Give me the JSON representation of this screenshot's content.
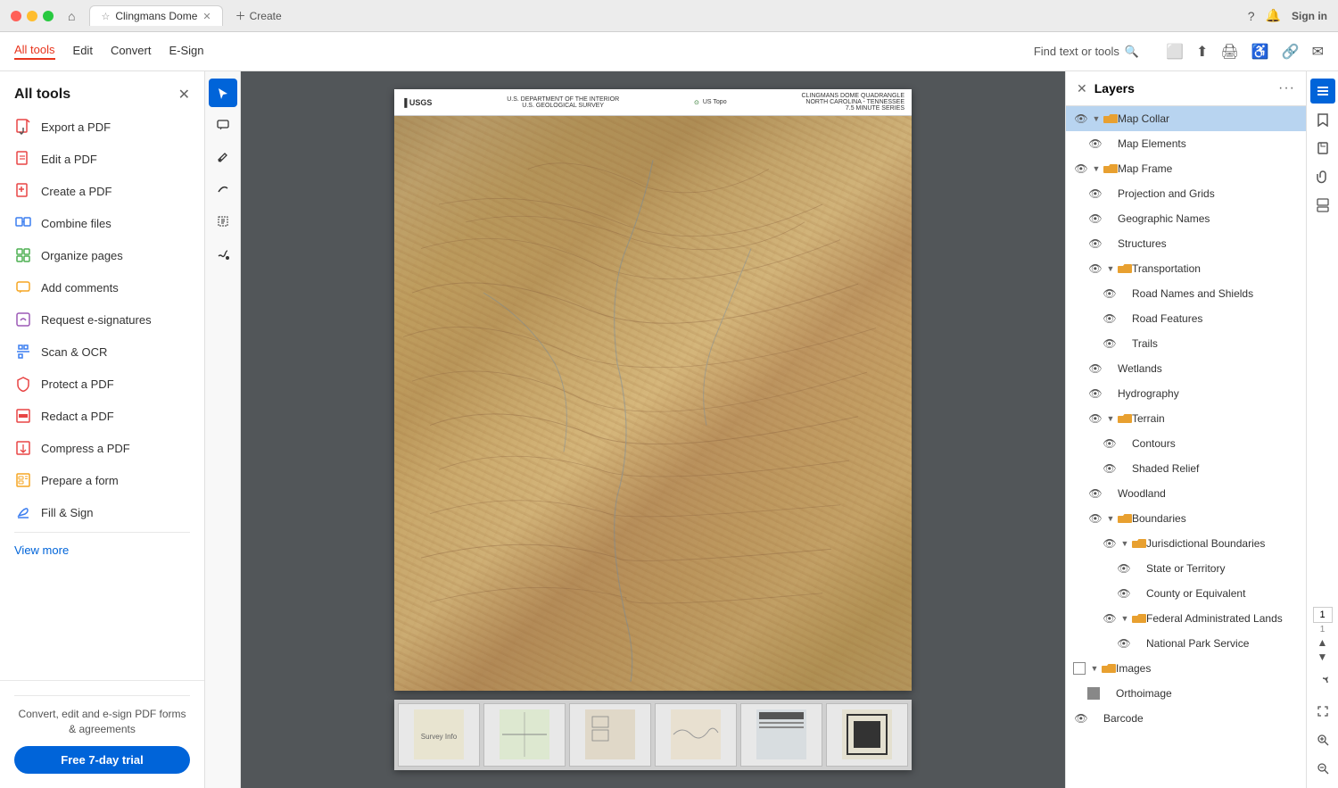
{
  "titlebar": {
    "tab_title": "Clingmans Dome",
    "new_tab_label": "Create"
  },
  "toolbar": {
    "items": [
      {
        "label": "All tools",
        "active": true
      },
      {
        "label": "Edit",
        "active": false
      },
      {
        "label": "Convert",
        "active": false
      },
      {
        "label": "E-Sign",
        "active": false
      }
    ],
    "search_placeholder": "Find text or tools"
  },
  "sidebar": {
    "title": "All tools",
    "items": [
      {
        "label": "Export a PDF",
        "icon": "export"
      },
      {
        "label": "Edit a PDF",
        "icon": "edit"
      },
      {
        "label": "Create a PDF",
        "icon": "create"
      },
      {
        "label": "Combine files",
        "icon": "combine"
      },
      {
        "label": "Organize pages",
        "icon": "organize"
      },
      {
        "label": "Add comments",
        "icon": "comment"
      },
      {
        "label": "Request e-signatures",
        "icon": "sign"
      },
      {
        "label": "Scan & OCR",
        "icon": "scan"
      },
      {
        "label": "Protect a PDF",
        "icon": "protect"
      },
      {
        "label": "Redact a PDF",
        "icon": "redact"
      },
      {
        "label": "Compress a PDF",
        "icon": "compress"
      },
      {
        "label": "Prepare a form",
        "icon": "form"
      },
      {
        "label": "Fill & Sign",
        "icon": "fill"
      }
    ],
    "view_more": "View more",
    "footer_text": "Convert, edit and e-sign PDF forms\n& agreements",
    "trial_button": "Free 7-day trial"
  },
  "tools": [
    {
      "icon": "cursor",
      "active": true
    },
    {
      "icon": "comment-tool",
      "active": false
    },
    {
      "icon": "pen",
      "active": false
    },
    {
      "icon": "arc",
      "active": false
    },
    {
      "icon": "text-select",
      "active": false
    },
    {
      "icon": "draw",
      "active": false
    }
  ],
  "layers": {
    "title": "Layers",
    "items": [
      {
        "name": "Map Collar",
        "level": 0,
        "has_toggle": true,
        "is_folder": true,
        "selected": true,
        "expanded": true,
        "has_eye": true
      },
      {
        "name": "Map Elements",
        "level": 1,
        "has_toggle": false,
        "is_folder": false,
        "selected": false,
        "has_eye": true
      },
      {
        "name": "Map Frame",
        "level": 0,
        "has_toggle": true,
        "is_folder": true,
        "selected": false,
        "expanded": true,
        "has_eye": true
      },
      {
        "name": "Projection and Grids",
        "level": 1,
        "has_toggle": false,
        "is_folder": false,
        "selected": false,
        "has_eye": true
      },
      {
        "name": "Geographic Names",
        "level": 1,
        "has_toggle": false,
        "is_folder": false,
        "selected": false,
        "has_eye": true
      },
      {
        "name": "Structures",
        "level": 1,
        "has_toggle": false,
        "is_folder": false,
        "selected": false,
        "has_eye": true
      },
      {
        "name": "Transportation",
        "level": 1,
        "has_toggle": true,
        "is_folder": true,
        "selected": false,
        "expanded": true,
        "has_eye": true
      },
      {
        "name": "Road Names and Shields",
        "level": 2,
        "has_toggle": false,
        "is_folder": false,
        "selected": false,
        "has_eye": true
      },
      {
        "name": "Road Features",
        "level": 2,
        "has_toggle": false,
        "is_folder": false,
        "selected": false,
        "has_eye": true
      },
      {
        "name": "Trails",
        "level": 2,
        "has_toggle": false,
        "is_folder": false,
        "selected": false,
        "has_eye": true
      },
      {
        "name": "Wetlands",
        "level": 1,
        "has_toggle": false,
        "is_folder": false,
        "selected": false,
        "has_eye": true
      },
      {
        "name": "Hydrography",
        "level": 1,
        "has_toggle": false,
        "is_folder": false,
        "selected": false,
        "has_eye": true
      },
      {
        "name": "Terrain",
        "level": 1,
        "has_toggle": true,
        "is_folder": true,
        "selected": false,
        "expanded": true,
        "has_eye": true
      },
      {
        "name": "Contours",
        "level": 2,
        "has_toggle": false,
        "is_folder": false,
        "selected": false,
        "has_eye": true
      },
      {
        "name": "Shaded Relief",
        "level": 2,
        "has_toggle": false,
        "is_folder": false,
        "selected": false,
        "has_eye": true
      },
      {
        "name": "Woodland",
        "level": 1,
        "has_toggle": false,
        "is_folder": false,
        "selected": false,
        "has_eye": true
      },
      {
        "name": "Boundaries",
        "level": 1,
        "has_toggle": true,
        "is_folder": true,
        "selected": false,
        "expanded": true,
        "has_eye": true
      },
      {
        "name": "Jurisdictional Boundaries",
        "level": 2,
        "has_toggle": true,
        "is_folder": true,
        "selected": false,
        "expanded": true,
        "has_eye": true
      },
      {
        "name": "State or Territory",
        "level": 3,
        "has_toggle": false,
        "is_folder": false,
        "selected": false,
        "has_eye": true
      },
      {
        "name": "County or Equivalent",
        "level": 3,
        "has_toggle": false,
        "is_folder": false,
        "selected": false,
        "has_eye": true
      },
      {
        "name": "Federal Administrated Lands",
        "level": 2,
        "has_toggle": true,
        "is_folder": true,
        "selected": false,
        "expanded": true,
        "has_eye": true
      },
      {
        "name": "National Park Service",
        "level": 3,
        "has_toggle": false,
        "is_folder": false,
        "selected": false,
        "has_eye": true
      },
      {
        "name": "Images",
        "level": 0,
        "has_toggle": true,
        "is_folder": true,
        "selected": false,
        "expanded": true,
        "has_eye": false,
        "checkbox": true
      },
      {
        "name": "Orthoimage",
        "level": 1,
        "has_toggle": false,
        "is_folder": false,
        "selected": false,
        "has_eye": true,
        "checkbox_checked": false
      },
      {
        "name": "Barcode",
        "level": 0,
        "has_toggle": false,
        "is_folder": false,
        "selected": false,
        "has_eye": true
      }
    ]
  },
  "right_icons": [
    {
      "icon": "layers",
      "active": true
    },
    {
      "icon": "bookmark"
    },
    {
      "icon": "attachment"
    },
    {
      "icon": "clip"
    },
    {
      "icon": "stacked"
    }
  ],
  "page_numbers": {
    "current": "1",
    "total": "1"
  }
}
